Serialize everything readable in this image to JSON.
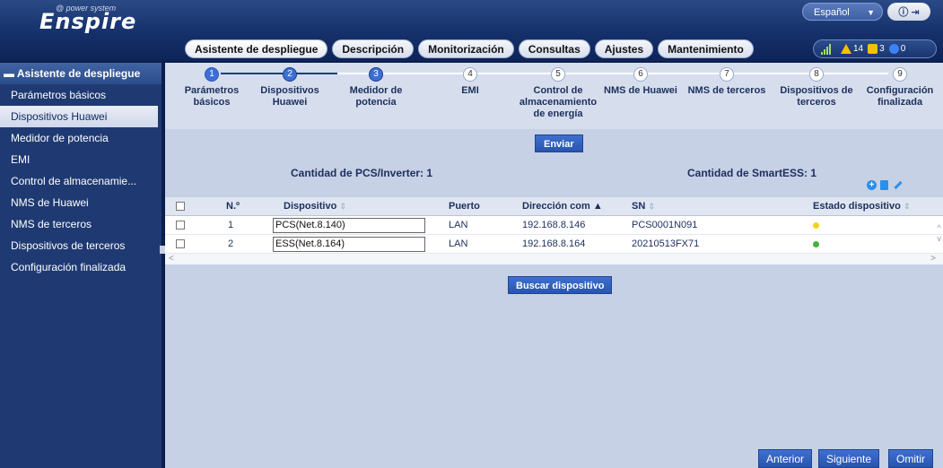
{
  "header": {
    "logo": "Enspire",
    "logo_sub": "@ power system",
    "language": "Español",
    "alarms": {
      "major": "14",
      "minor": "3",
      "info": "0"
    }
  },
  "tabs": [
    "Asistente de despliegue",
    "Descripción",
    "Monitorización",
    "Consultas",
    "Ajustes",
    "Mantenimiento"
  ],
  "sidebar": {
    "title": "Asistente de despliegue",
    "items": [
      "Parámetros básicos",
      "Dispositivos Huawei",
      "Medidor de potencia",
      "EMI",
      "Control de almacenamie...",
      "NMS de Huawei",
      "NMS de terceros",
      "Dispositivos de terceros",
      "Configuración finalizada"
    ],
    "active_index": 1
  },
  "steps": [
    {
      "num": "1",
      "label": "Parámetros básicos",
      "state": "done"
    },
    {
      "num": "2",
      "label": "Dispositivos Huawei",
      "state": "current"
    },
    {
      "num": "3",
      "label": "Medidor de potencia",
      "state": "current"
    },
    {
      "num": "4",
      "label": "EMI",
      "state": "pending"
    },
    {
      "num": "5",
      "label": "Control de almacenamiento de energía",
      "state": "pending"
    },
    {
      "num": "6",
      "label": "NMS de Huawei",
      "state": "pending"
    },
    {
      "num": "7",
      "label": "NMS de terceros",
      "state": "pending"
    },
    {
      "num": "8",
      "label": "Dispositivos de terceros",
      "state": "pending"
    },
    {
      "num": "9",
      "label": "Configuración finalizada",
      "state": "pending"
    }
  ],
  "actions": {
    "enviar": "Enviar",
    "buscar": "Buscar dispositivo",
    "anterior": "Anterior",
    "siguiente": "Siguiente",
    "omitir": "Omitir"
  },
  "counts": {
    "pcs": "Cantidad de PCS/Inverter: 1",
    "ess": "Cantidad de SmartESS: 1"
  },
  "table": {
    "columns": [
      "N.º",
      "Dispositivo",
      "Puerto",
      "Dirección com",
      "SN",
      "Estado dispositivo"
    ],
    "rows": [
      {
        "no": "1",
        "device": "PCS(Net.8.140)",
        "port": "LAN",
        "address": "192.168.8.146",
        "sn": "PCS0001N091",
        "status_color": "#f2d21e"
      },
      {
        "no": "2",
        "device": "ESS(Net.8.164)",
        "port": "LAN",
        "address": "192.168.8.164",
        "sn": "20210513FX71",
        "status_color": "#3fb53a"
      }
    ]
  }
}
